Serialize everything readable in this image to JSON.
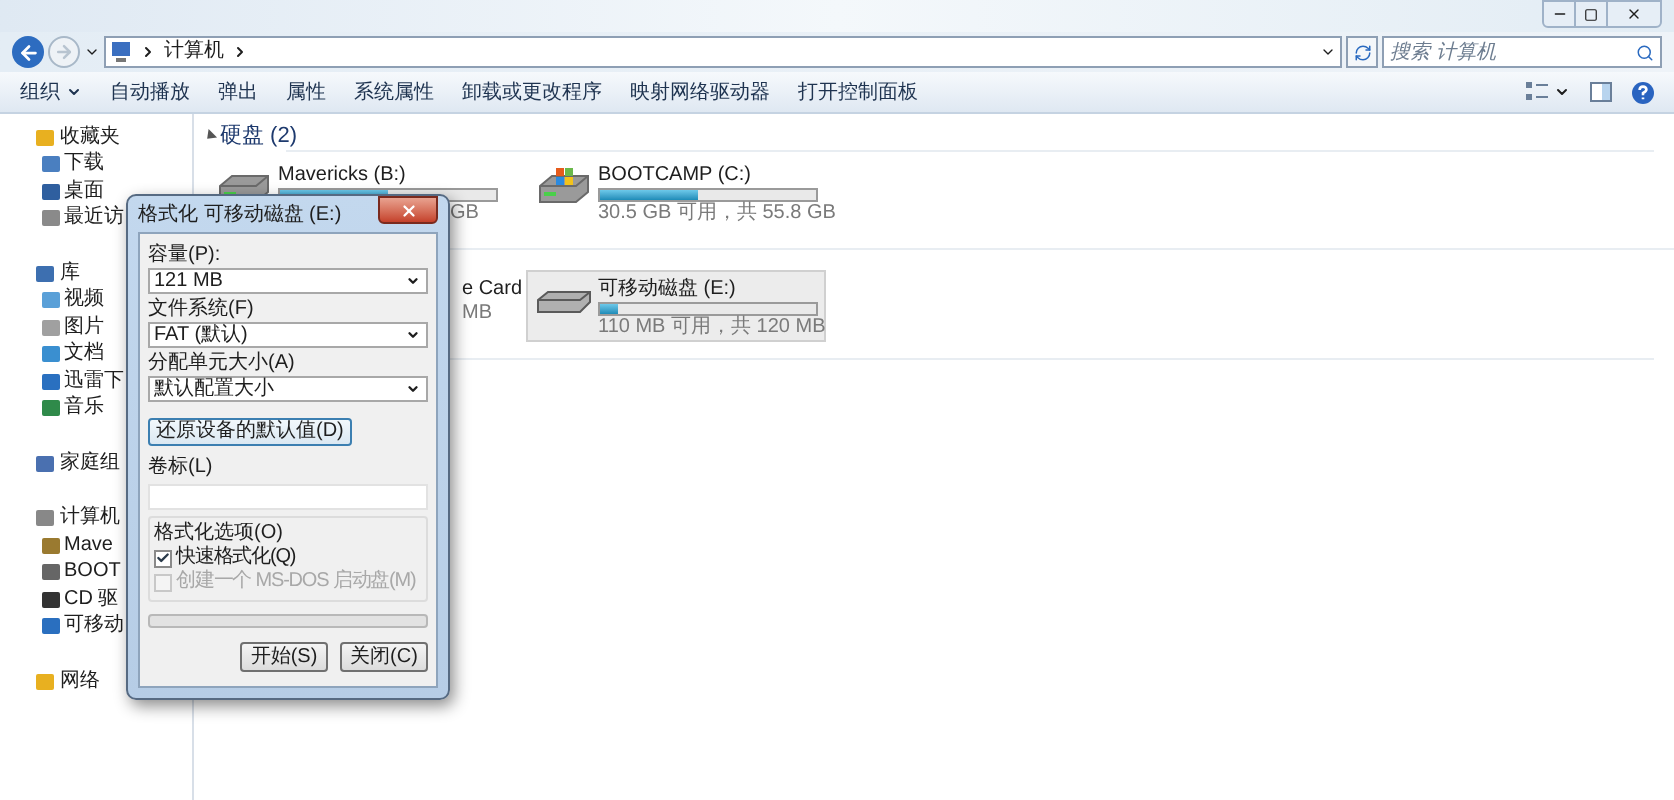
{
  "address_bar": {
    "path": [
      "计算机"
    ]
  },
  "search": {
    "placeholder": "搜索 计算机"
  },
  "toolbar": {
    "items": [
      {
        "label": "组织",
        "kind": "menu"
      },
      {
        "label": "自动播放",
        "kind": "button"
      },
      {
        "label": "弹出",
        "kind": "button"
      },
      {
        "label": "属性",
        "kind": "button"
      },
      {
        "label": "系统属性",
        "kind": "button"
      },
      {
        "label": "卸载或更改程序",
        "kind": "button"
      },
      {
        "label": "映射网络驱动器",
        "kind": "button"
      },
      {
        "label": "打开控制面板",
        "kind": "button"
      }
    ]
  },
  "sidebar": {
    "groups": [
      {
        "label": "收藏夹",
        "items": [
          {
            "label": "下载"
          },
          {
            "label": "桌面"
          },
          {
            "label": "最近访"
          }
        ]
      },
      {
        "label": "库",
        "items": [
          {
            "label": "视频"
          },
          {
            "label": "图片"
          },
          {
            "label": "文档"
          },
          {
            "label": "迅雷下"
          },
          {
            "label": "音乐"
          }
        ]
      },
      {
        "label": "家庭组"
      },
      {
        "label": "计算机",
        "items": [
          {
            "label": "Mave"
          },
          {
            "label": "BOOT"
          },
          {
            "label": "CD 驱"
          },
          {
            "label": "可移动"
          }
        ]
      },
      {
        "label": "网络"
      }
    ]
  },
  "content": {
    "sections": [
      {
        "title": "硬盘 (2)",
        "expanded": true,
        "drives": [
          {
            "kind": "hdd",
            "name": "Mavericks (B:)",
            "level": 0.5,
            "caption": "GB",
            "covered": true,
            "selected": false
          },
          {
            "kind": "system",
            "name": "BOOTCAMP (C:)",
            "level": 0.45,
            "caption": "30.5 GB 可用，共 55.8 GB",
            "covered": false,
            "selected": false
          }
        ]
      },
      {
        "drives": [
          {
            "kind": "card",
            "name": "e Card",
            "caption": "MB",
            "covered": true,
            "selected": false
          },
          {
            "kind": "removable",
            "name": "可移动磁盘 (E:)",
            "level": 0.08,
            "caption": "110 MB 可用，共 120 MB",
            "covered": false,
            "selected": true
          }
        ]
      }
    ]
  },
  "dialog": {
    "title": "格式化 可移动磁盘 (E:)",
    "fields": [
      {
        "kind": "select",
        "label": "容量(P):",
        "value": "121 MB"
      },
      {
        "kind": "select",
        "label": "文件系统(F)",
        "value": "FAT (默认)"
      },
      {
        "kind": "select",
        "label": "分配单元大小(A)",
        "value": "默认配置大小"
      },
      {
        "kind": "button",
        "label": "还原设备的默认值(D)"
      },
      {
        "kind": "input",
        "label": "卷标(L)"
      }
    ],
    "options": {
      "title": "格式化选项(O)",
      "items": [
        {
          "label": "快速格式化(Q)",
          "checked": true,
          "disabled": false
        },
        {
          "label": "创建一个 MS-DOS 启动盘(M)",
          "checked": false,
          "disabled": true
        }
      ]
    },
    "progress": {
      "level": 0
    },
    "buttons": [
      "开始(S)",
      "关闭(C)"
    ]
  }
}
